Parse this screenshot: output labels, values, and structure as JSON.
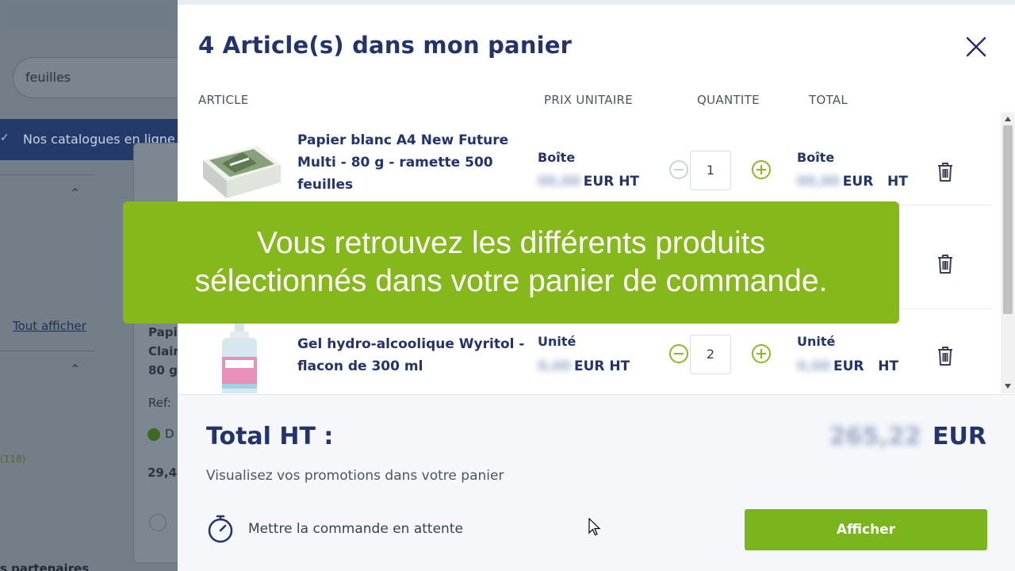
{
  "background": {
    "search_value": "feuilles",
    "nav_label": "Nos catalogues en ligne",
    "show_all_link": "Tout afficher",
    "filter_count": "(118)",
    "product_snippet": [
      "Papi",
      "Clair",
      "80 g"
    ],
    "ref_label": "Ref:",
    "availability_letter": "D",
    "price_snippet": "29,4",
    "bottom_text": "s partenaires"
  },
  "cart": {
    "title": "4 Article(s) dans mon panier",
    "columns": {
      "article": "ARTICLE",
      "unit_price": "PRIX UNITAIRE",
      "quantity": "QUANTITE",
      "total": "TOTAL"
    },
    "items": [
      {
        "name": "Papier blanc A4 New Future Multi - 80 g - ramette 500 feuilles",
        "unit": "Boîte",
        "unit_price_hidden": "00,00",
        "unit_price_suffix": "EUR HT",
        "quantity": "1",
        "total_unit": "Boîte",
        "total_hidden": "00,00",
        "total_suffix": "EUR   HT"
      },
      {
        "name": "",
        "unit": "",
        "quantity": "",
        "total_suffix": ""
      },
      {
        "name": "Gel hydro-alcoolique Wyritol - flacon de 300 ml",
        "unit": "Unité",
        "unit_price_hidden": "0,00",
        "unit_price_suffix": "EUR HT",
        "quantity": "2",
        "total_unit": "Unité",
        "total_hidden": "0,00",
        "total_suffix": "EUR   HT"
      }
    ],
    "footer": {
      "total_label": "Total HT :",
      "total_hidden": "265,22",
      "total_currency": "EUR",
      "promo_text": "Visualisez vos promotions dans votre panier",
      "hold_label": "Mettre la commande en attente",
      "show_button": "Afficher"
    }
  },
  "caption": {
    "line1": "Vous retrouvez les différents produits",
    "line2": "sélectionnés dans votre panier de commande."
  },
  "colors": {
    "navy": "#23336e",
    "green": "#7ab51d",
    "caption_green": "#85b81a"
  }
}
